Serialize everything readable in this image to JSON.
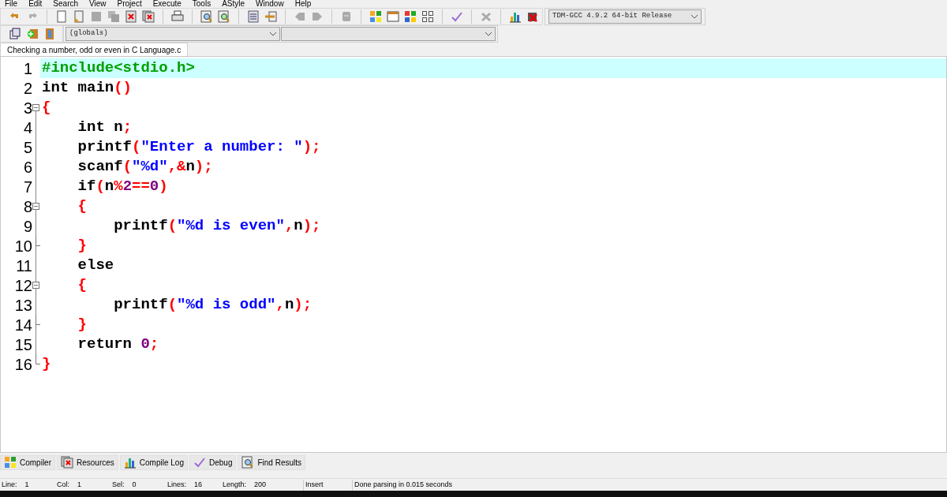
{
  "menu": [
    "File",
    "Edit",
    "Search",
    "View",
    "Project",
    "Execute",
    "Tools",
    "AStyle",
    "Window",
    "Help"
  ],
  "compiler_select": {
    "value": "TDM-GCC 4.9.2 64-bit Release"
  },
  "scope_select": {
    "value": "(globals)"
  },
  "file_tabs": [
    {
      "label": "Checking a number, odd or even in C Language.c",
      "selected": true
    }
  ],
  "editor": {
    "lines": [
      {
        "number": "1",
        "fold_start": false,
        "fold_end": false,
        "current": true,
        "tokens": [
          {
            "kind": "preproc",
            "text": "#include<stdio.h>"
          }
        ]
      },
      {
        "number": "2",
        "fold_start": false,
        "fold_end": false,
        "current": false,
        "tokens": [
          {
            "kind": "plain",
            "text": "int main"
          },
          {
            "kind": "punct",
            "text": "()"
          }
        ]
      },
      {
        "number": "3",
        "fold_start": true,
        "fold_end": false,
        "current": false,
        "tokens": [
          {
            "kind": "punct",
            "text": "{"
          }
        ]
      },
      {
        "number": "4",
        "fold_start": false,
        "fold_end": false,
        "current": false,
        "tokens": [
          {
            "kind": "plain",
            "text": "    int n"
          },
          {
            "kind": "punct",
            "text": ";"
          }
        ]
      },
      {
        "number": "5",
        "fold_start": false,
        "fold_end": false,
        "current": false,
        "tokens": [
          {
            "kind": "plain",
            "text": "    printf"
          },
          {
            "kind": "punct",
            "text": "("
          },
          {
            "kind": "string",
            "text": "\"Enter a number: \""
          },
          {
            "kind": "punct",
            "text": ");"
          }
        ]
      },
      {
        "number": "6",
        "fold_start": false,
        "fold_end": false,
        "current": false,
        "tokens": [
          {
            "kind": "plain",
            "text": "    scanf"
          },
          {
            "kind": "punct",
            "text": "("
          },
          {
            "kind": "string",
            "text": "\"%d\""
          },
          {
            "kind": "punct",
            "text": ",&"
          },
          {
            "kind": "plain",
            "text": "n"
          },
          {
            "kind": "punct",
            "text": ");"
          }
        ]
      },
      {
        "number": "7",
        "fold_start": false,
        "fold_end": false,
        "current": false,
        "tokens": [
          {
            "kind": "plain",
            "text": "    if"
          },
          {
            "kind": "punct",
            "text": "("
          },
          {
            "kind": "plain",
            "text": "n"
          },
          {
            "kind": "punct",
            "text": "%"
          },
          {
            "kind": "number",
            "text": "2"
          },
          {
            "kind": "punct",
            "text": "=="
          },
          {
            "kind": "number",
            "text": "0"
          },
          {
            "kind": "punct",
            "text": ")"
          }
        ]
      },
      {
        "number": "8",
        "fold_start": true,
        "fold_end": false,
        "current": false,
        "tokens": [
          {
            "kind": "punct",
            "text": "    {"
          }
        ]
      },
      {
        "number": "9",
        "fold_start": false,
        "fold_end": false,
        "current": false,
        "tokens": [
          {
            "kind": "plain",
            "text": "        printf"
          },
          {
            "kind": "punct",
            "text": "("
          },
          {
            "kind": "string",
            "text": "\"%d is even\""
          },
          {
            "kind": "punct",
            "text": ","
          },
          {
            "kind": "plain",
            "text": "n"
          },
          {
            "kind": "punct",
            "text": ");"
          }
        ]
      },
      {
        "number": "10",
        "fold_start": false,
        "fold_end": true,
        "current": false,
        "tokens": [
          {
            "kind": "punct",
            "text": "    }"
          }
        ]
      },
      {
        "number": "11",
        "fold_start": false,
        "fold_end": false,
        "current": false,
        "tokens": [
          {
            "kind": "plain",
            "text": "    else"
          }
        ]
      },
      {
        "number": "12",
        "fold_start": true,
        "fold_end": false,
        "current": false,
        "tokens": [
          {
            "kind": "punct",
            "text": "    {"
          }
        ]
      },
      {
        "number": "13",
        "fold_start": false,
        "fold_end": false,
        "current": false,
        "tokens": [
          {
            "kind": "plain",
            "text": "        printf"
          },
          {
            "kind": "punct",
            "text": "("
          },
          {
            "kind": "string",
            "text": "\"%d is odd\""
          },
          {
            "kind": "punct",
            "text": ","
          },
          {
            "kind": "plain",
            "text": "n"
          },
          {
            "kind": "punct",
            "text": ");"
          }
        ]
      },
      {
        "number": "14",
        "fold_start": false,
        "fold_end": true,
        "current": false,
        "tokens": [
          {
            "kind": "punct",
            "text": "    }"
          }
        ]
      },
      {
        "number": "15",
        "fold_start": false,
        "fold_end": false,
        "current": false,
        "tokens": [
          {
            "kind": "plain",
            "text": "    return "
          },
          {
            "kind": "number",
            "text": "0"
          },
          {
            "kind": "punct",
            "text": ";"
          }
        ]
      },
      {
        "number": "16",
        "fold_start": false,
        "fold_end": true,
        "current": false,
        "tokens": [
          {
            "kind": "punct",
            "text": "}"
          }
        ]
      }
    ]
  },
  "bottom_tabs": [
    {
      "label": "Compiler",
      "selected": false
    },
    {
      "label": "Resources",
      "selected": false
    },
    {
      "label": "Compile Log",
      "selected": false
    },
    {
      "label": "Debug",
      "selected": false
    },
    {
      "label": "Find Results",
      "selected": false
    }
  ],
  "status_bar": [
    {
      "label": "Line:",
      "value": "1"
    },
    {
      "label": "Col:",
      "value": "1"
    },
    {
      "label": "Sel:",
      "value": "0"
    },
    {
      "label": "Lines:",
      "value": "16"
    },
    {
      "label": "Length:",
      "value": "200"
    }
  ],
  "status_mode": "Insert",
  "status_message": "Done parsing in 0.015 seconds"
}
